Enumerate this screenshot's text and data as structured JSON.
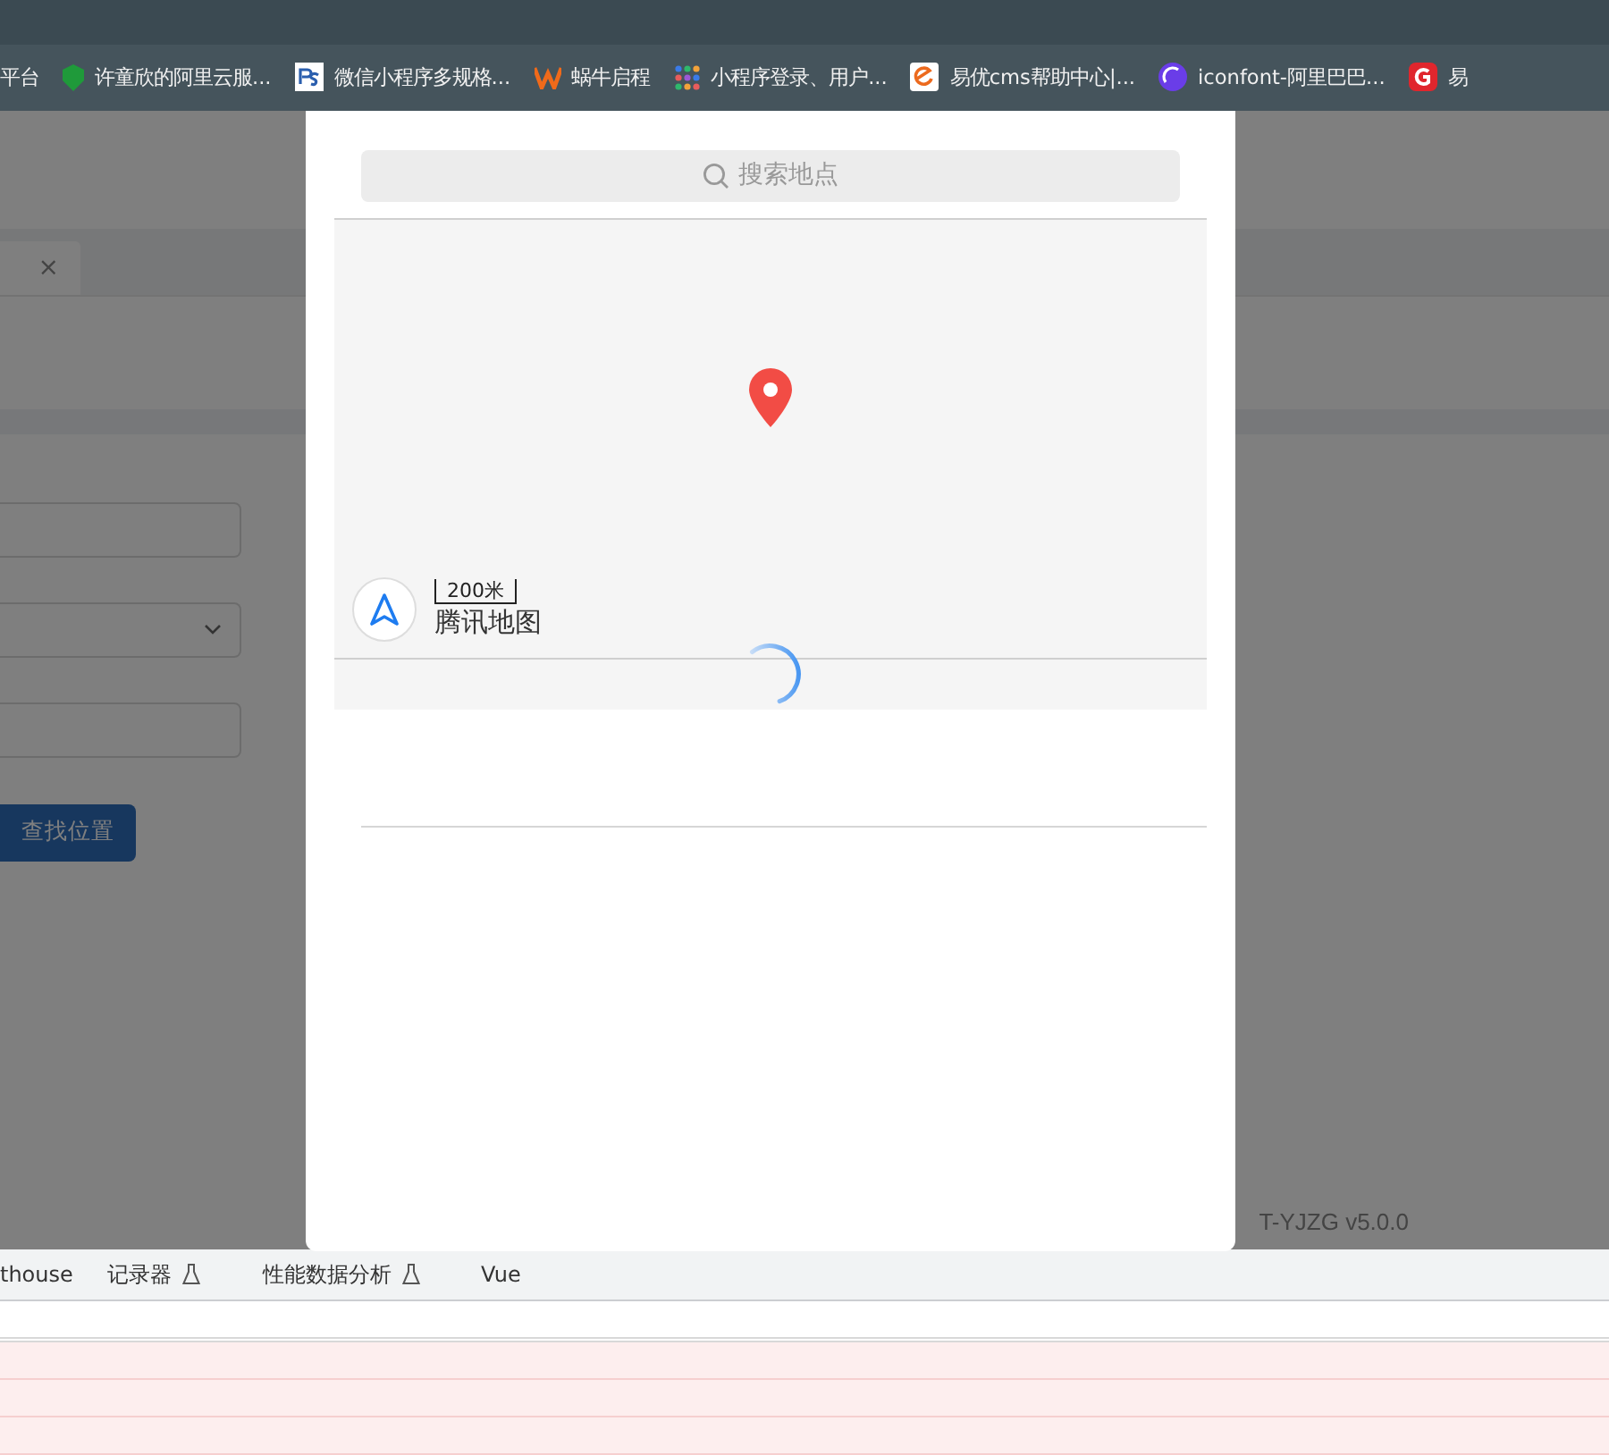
{
  "bookmarks": [
    {
      "label": "平台",
      "kind": "none"
    },
    {
      "label": "许童欣的阿里云服...",
      "kind": "shield"
    },
    {
      "label": "微信小程序多规格...",
      "kind": "ps"
    },
    {
      "label": "蜗牛启程",
      "kind": "w"
    },
    {
      "label": "小程序登录、用户...",
      "kind": "dots"
    },
    {
      "label": "易优cms帮助中心|...",
      "kind": "e"
    },
    {
      "label": "iconfont-阿里巴巴...",
      "kind": "ball"
    },
    {
      "label": "易",
      "kind": "g"
    }
  ],
  "app": {
    "tab_close": "×",
    "select_chevron": true,
    "button": "查找位置",
    "version": "T-YJZG v5.0.0"
  },
  "dialog": {
    "search": {
      "placeholder": "搜索地点"
    },
    "map": {
      "scale": "200米",
      "brand": "腾讯地图"
    },
    "loading": true
  },
  "devtools": {
    "tabs": [
      {
        "label": "thouse",
        "experimental": false
      },
      {
        "label": "记录器",
        "experimental": true
      },
      {
        "label": "性能数据分析",
        "experimental": true
      },
      {
        "label": "Vue",
        "experimental": false
      }
    ]
  }
}
